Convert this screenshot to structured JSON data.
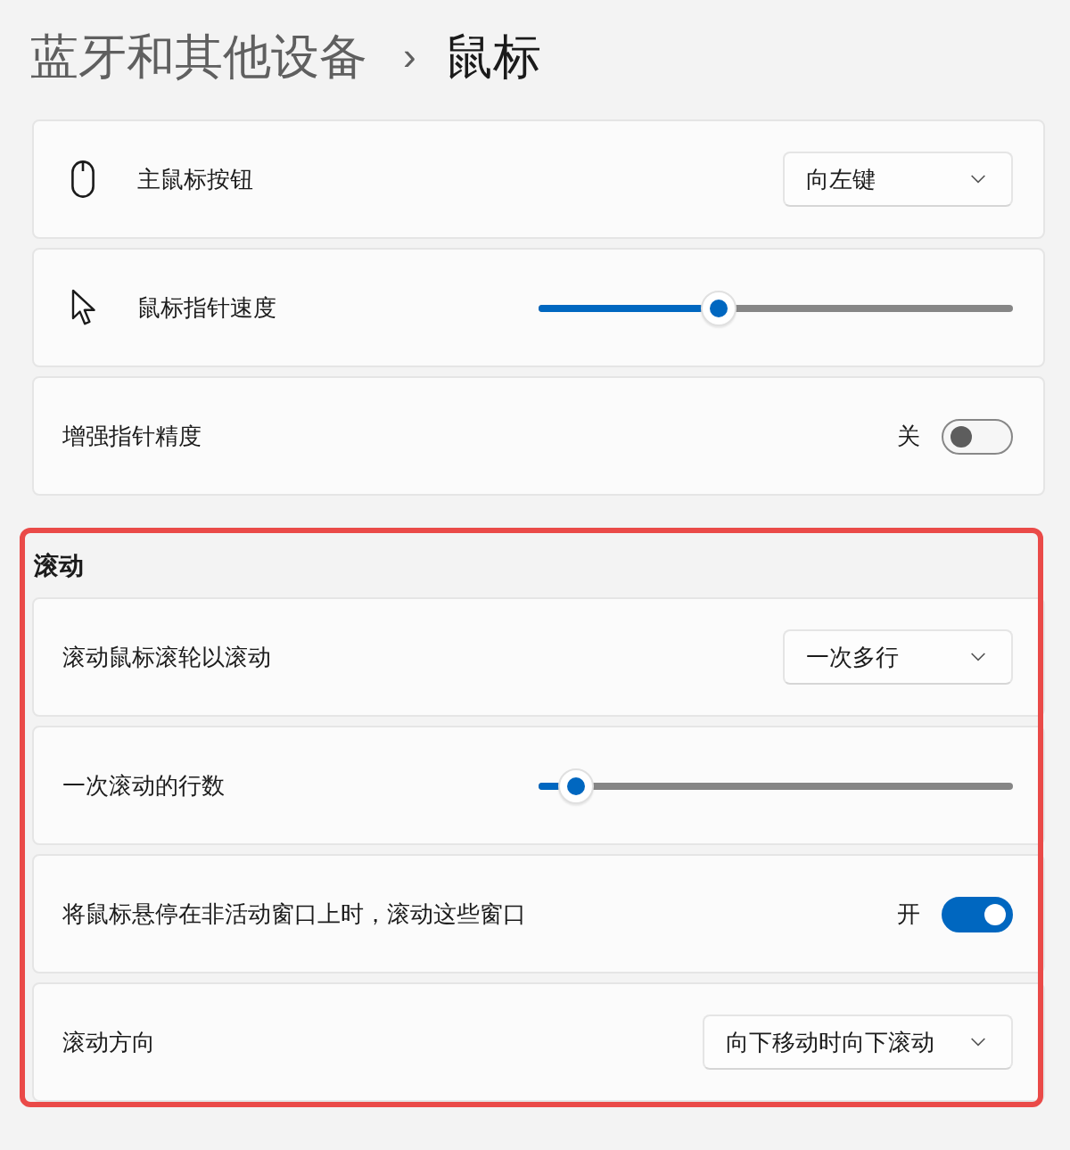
{
  "breadcrumb": {
    "parent": "蓝牙和其他设备",
    "separator": "›",
    "current": "鼠标"
  },
  "settings": [
    {
      "kind": "dropdown",
      "label": "主鼠标按钮",
      "value": "向左键"
    },
    {
      "kind": "slider",
      "label": "鼠标指针速度",
      "level": 0.38
    },
    {
      "kind": "toggle",
      "label": "增强指针精度",
      "state_label": "关",
      "on": false
    }
  ],
  "scroll": {
    "title": "滚动",
    "highlighted": true,
    "settings": [
      {
        "kind": "dropdown",
        "label": "滚动鼠标滚轮以滚动",
        "value": "一次多行"
      },
      {
        "kind": "slider",
        "label": "一次滚动的行数",
        "level": 0.08
      },
      {
        "kind": "toggle",
        "label": "将鼠标悬停在非活动窗口上时，滚动这些窗口",
        "state_label": "开",
        "on": true
      },
      {
        "kind": "dropdown",
        "label": "滚动方向",
        "value": "向下移动时向下滚动"
      }
    ]
  }
}
